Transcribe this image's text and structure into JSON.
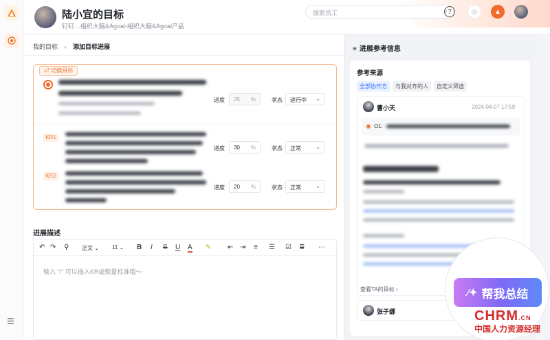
{
  "header": {
    "title": "陆小宜的目标",
    "subtitle": "钉钉…组织大脑&Agoal-组织大脑&Agoal产品",
    "search_placeholder": "搜索员工"
  },
  "breadcrumb": {
    "root": "我的目标",
    "current": "添加目标进展"
  },
  "card": {
    "switch_label": "切换目标",
    "progress_label": "进度",
    "status_label": "状态",
    "objective": {
      "progress": "25",
      "status": "进行中"
    },
    "krs": [
      {
        "badge": "KR1",
        "progress": "30",
        "status": "正常"
      },
      {
        "badge": "KR2",
        "progress": "20",
        "status": "正常"
      }
    ],
    "pct": "%"
  },
  "editor": {
    "title": "进展描述",
    "style": "正文",
    "size": "11",
    "placeholder": "输入 \"/\" 可以插入KR或衡量标准哦～"
  },
  "right": {
    "title": "进展参考信息",
    "section": "参考来源",
    "tabs": [
      "全部协作方",
      "与我对齐的人",
      "自定义筛选"
    ],
    "user1": {
      "name": "曹小天",
      "time": "2024-04-07 17:59",
      "o_label": "O1:"
    },
    "look_goal": "查看TA的目标",
    "user2": {
      "name": "张子娜"
    }
  },
  "summary_button": "帮我总结",
  "watermark": {
    "brand": "CHRM",
    "suffix": ".CN",
    "tagline": "中国人力资源经理"
  },
  "colors": {
    "accent": "#f06a25",
    "link": "#3370ff"
  }
}
